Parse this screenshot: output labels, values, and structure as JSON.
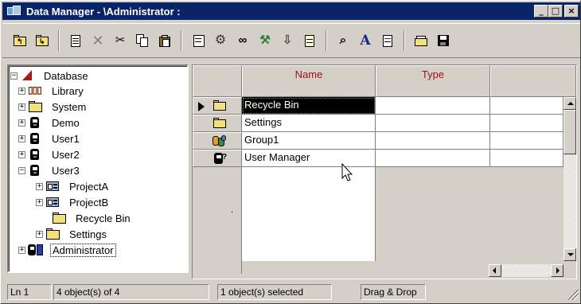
{
  "window": {
    "title": "Data Manager - \\Administrator :",
    "controls": {
      "minimize": "_",
      "maximize": "□",
      "close": "×"
    }
  },
  "toolbar": {
    "buttons": [
      "folder-up-icon",
      "folder-down-icon",
      "new-icon",
      "delete-icon",
      "cut-icon",
      "copy-icon",
      "paste-icon",
      "properties-icon",
      "settings-icon",
      "link-icon",
      "tools-icon",
      "import-icon",
      "export-icon",
      "find-icon",
      "font-icon",
      "edit-icon",
      "open-icon",
      "save-icon"
    ]
  },
  "tree": {
    "items": [
      {
        "label": "Database",
        "toggle": "−",
        "icon": "database-icon"
      },
      {
        "label": "Library",
        "toggle": "+",
        "icon": "library-icon"
      },
      {
        "label": "System",
        "toggle": "+",
        "icon": "folder-icon"
      },
      {
        "label": "Demo",
        "toggle": "+",
        "icon": "user-icon"
      },
      {
        "label": "User1",
        "toggle": "+",
        "icon": "user-icon"
      },
      {
        "label": "User2",
        "toggle": "+",
        "icon": "user-icon"
      },
      {
        "label": "User3",
        "toggle": "−",
        "icon": "user-icon"
      },
      {
        "label": "ProjectA",
        "toggle": "+",
        "icon": "project-icon"
      },
      {
        "label": "ProjectB",
        "toggle": "+",
        "icon": "project-icon"
      },
      {
        "label": "Recycle Bin",
        "toggle": "",
        "icon": "folder-icon"
      },
      {
        "label": "Settings",
        "toggle": "+",
        "icon": "folder-icon"
      },
      {
        "label": "Administrator",
        "toggle": "+",
        "icon": "admin-icon"
      }
    ]
  },
  "grid": {
    "columns": [
      "Name",
      "Type"
    ],
    "rows": [
      {
        "name": "Recycle Bin",
        "type": "",
        "icon": "folder-icon",
        "current": true
      },
      {
        "name": "Settings",
        "type": "",
        "icon": "folder-icon",
        "current": false
      },
      {
        "name": "Group1",
        "type": "",
        "icon": "group-icon",
        "current": false
      },
      {
        "name": "User Manager",
        "type": "",
        "icon": "user-manager-icon",
        "current": false
      }
    ],
    "row_header_dot": "."
  },
  "status": {
    "line": "Ln 1",
    "objects": "4 object(s) of 4",
    "selected": "1 object(s) selected",
    "mode": "Drag & Drop"
  },
  "colors": {
    "titlebar": "#0a246a",
    "face": "#d4d0c8",
    "header_text": "#a01010"
  }
}
